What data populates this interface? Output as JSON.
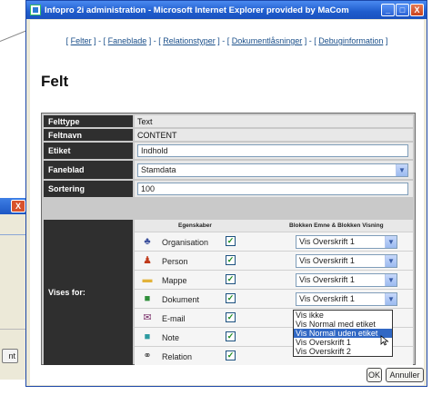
{
  "background": {
    "close_glyph": "X",
    "button_label": "nt"
  },
  "window": {
    "title": "Infopro 2i administration - Microsoft Internet Explorer provided by MaCom",
    "minimize_glyph": "_",
    "maximize_glyph": "□",
    "close_glyph": "X"
  },
  "nav": {
    "items": [
      "Felter",
      "Faneblade",
      "Relationstyper",
      "Dokumentlåsninger",
      "Debuginformation"
    ]
  },
  "page": {
    "title": "Felt"
  },
  "form": {
    "felttype": {
      "label": "Felttype",
      "value": "Text"
    },
    "feltnavn": {
      "label": "Feltnavn",
      "value": "CONTENT"
    },
    "etiket": {
      "label": "Etiket",
      "value": "Indhold"
    },
    "faneblad": {
      "label": "Faneblad",
      "value": "Stamdata"
    },
    "sortering": {
      "label": "Sortering",
      "value": "100"
    },
    "vises_label": "Vises for:",
    "grid": {
      "col_properties": "Egenskaber",
      "col_display": "Blokken Emne & Blokken Visning",
      "rows": [
        {
          "name": "Organisation",
          "icon": "organisation-icon",
          "checked": "✓",
          "display": "Vis Overskrift 1",
          "color": "#3b4f9c",
          "glyph": "♣"
        },
        {
          "name": "Person",
          "icon": "person-icon",
          "checked": "✓",
          "display": "Vis Overskrift 1",
          "color": "#c03a1a",
          "glyph": "♟"
        },
        {
          "name": "Mappe",
          "icon": "folder-icon",
          "checked": "✓",
          "display": "Vis Overskrift 1",
          "color": "#e2b23a",
          "glyph": "▬"
        },
        {
          "name": "Dokument",
          "icon": "document-icon",
          "checked": "✓",
          "display": "Vis Overskrift 1",
          "color": "#2f8f3a",
          "glyph": "■"
        },
        {
          "name": "E-mail",
          "icon": "email-icon",
          "checked": "✓",
          "display": "",
          "color": "#7a2f6a",
          "glyph": "✉"
        },
        {
          "name": "Note",
          "icon": "note-icon",
          "checked": "✓",
          "display": "",
          "color": "#2c9aa0",
          "glyph": "■"
        },
        {
          "name": "Relation",
          "icon": "relation-icon",
          "checked": "✓",
          "display": "",
          "color": "#555555",
          "glyph": "⚭"
        }
      ]
    },
    "dropdown_options": [
      "Vis ikke",
      "Vis Normal med etiket",
      "Vis Normal uden etiket",
      "Vis Overskrift 1",
      "Vis Overskrift 2"
    ],
    "dropdown_selected_index": 2
  },
  "buttons": {
    "ok": "OK",
    "cancel": "Annuller"
  },
  "colors": {
    "title_bar": "#1f5ccc",
    "label_bg": "#2f2f2f",
    "selection": "#3168c4",
    "link": "#1a4f8a"
  }
}
